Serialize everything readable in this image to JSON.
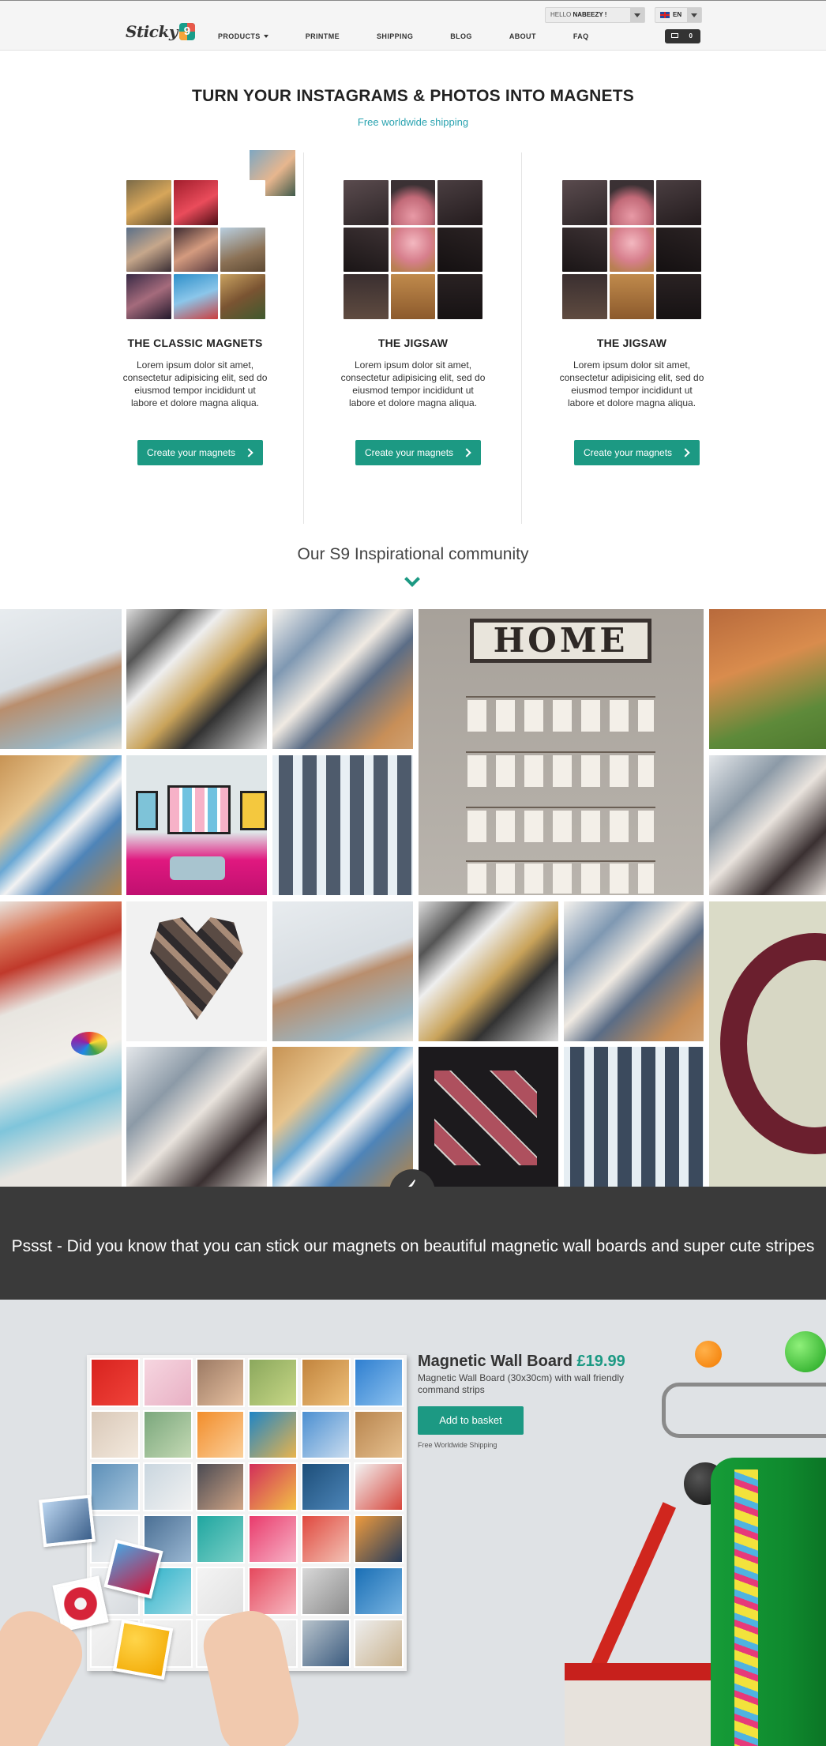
{
  "header": {
    "logo_text": "Sticky",
    "logo_number": "9",
    "nav": [
      {
        "label": "PRODUCTS",
        "dropdown": true
      },
      {
        "label": "PRINTME"
      },
      {
        "label": "SHIPPING"
      },
      {
        "label": "BLOG"
      },
      {
        "label": "ABOUT"
      },
      {
        "label": "FAQ"
      }
    ],
    "greeting": "HELLO",
    "username": "NABEEZY !",
    "language": "EN",
    "cart_count": "0"
  },
  "hero": {
    "title": "TURN YOUR INSTAGRAMS & PHOTOS INTO MAGNETS",
    "subtitle": "Free worldwide shipping"
  },
  "products": [
    {
      "title": "THE CLASSIC MAGNETS",
      "description": "Lorem ipsum dolor sit amet, consectetur adipisicing elit, sed do eiusmod tempor incididunt ut labore et dolore magna aliqua.",
      "button": "Create your magnets"
    },
    {
      "title": "THE JIGSAW",
      "description": "Lorem ipsum dolor sit amet, consectetur adipisicing elit, sed do eiusmod tempor incididunt ut labore et dolore magna aliqua.",
      "button": "Create your magnets"
    },
    {
      "title": "THE JIGSAW",
      "description": "Lorem ipsum dolor sit amet, consectetur adipisicing elit, sed do eiusmod tempor incididunt ut labore et dolore magna aliqua.",
      "button": "Create your magnets"
    }
  ],
  "community": {
    "title": "Our S9 Inspirational community",
    "home_sign": "HOME"
  },
  "banner": {
    "text": "Pssst - Did you know that you can stick our magnets on beautiful magnetic wall boards and super cute stripes"
  },
  "wall_board": {
    "title": "Magnetic Wall Board",
    "price": "£19.99",
    "description": "Magnetic Wall Board (30x30cm) with wall friendly command strips",
    "button": "Add to basket",
    "shipping": "Free Worldwide Shipping"
  },
  "colors": {
    "accent": "#1c9983",
    "link": "#2aa3b0",
    "banner": "#3a3a3a"
  }
}
